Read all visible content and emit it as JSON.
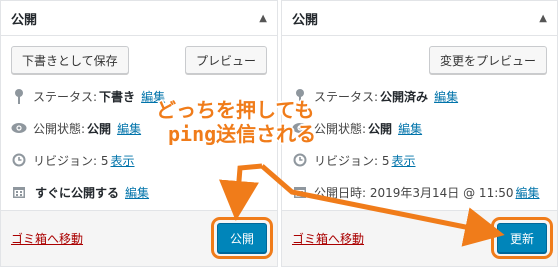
{
  "left": {
    "title": "公開",
    "save_draft": "下書きとして保存",
    "preview": "プレビュー",
    "status_label": "ステータス:",
    "status_value": "下書き",
    "status_edit": "編集",
    "visibility_label": "公開状態:",
    "visibility_value": "公開",
    "visibility_edit": "編集",
    "revisions_label": "リビジョン: 5",
    "revisions_link": "表示",
    "schedule_label": "すぐに公開する",
    "schedule_edit": "編集",
    "trash": "ゴミ箱へ移動",
    "publish_button": "公開"
  },
  "right": {
    "title": "公開",
    "preview_changes": "変更をプレビュー",
    "status_label": "ステータス:",
    "status_value": "公開済み",
    "status_edit": "編集",
    "visibility_label": "公開状態:",
    "visibility_value": "公開",
    "visibility_edit": "編集",
    "revisions_label": "リビジョン: 5",
    "revisions_link": "表示",
    "date_label": "公開日時: 2019年3月14日 @ 11:50",
    "date_edit": "編集",
    "trash": "ゴミ箱へ移動",
    "update_button": "更新"
  },
  "annotation": {
    "line1": "どっちを押しても",
    "line2": "ping送信される",
    "color": "#f07c1a"
  },
  "icons": [
    "pin-icon",
    "eye-icon",
    "history-icon",
    "calendar-icon",
    "triangle-up-icon"
  ],
  "colors": {
    "primary": "#0085ba",
    "link": "#0073aa",
    "trash": "#a00000",
    "highlight": "#f07c1a"
  }
}
